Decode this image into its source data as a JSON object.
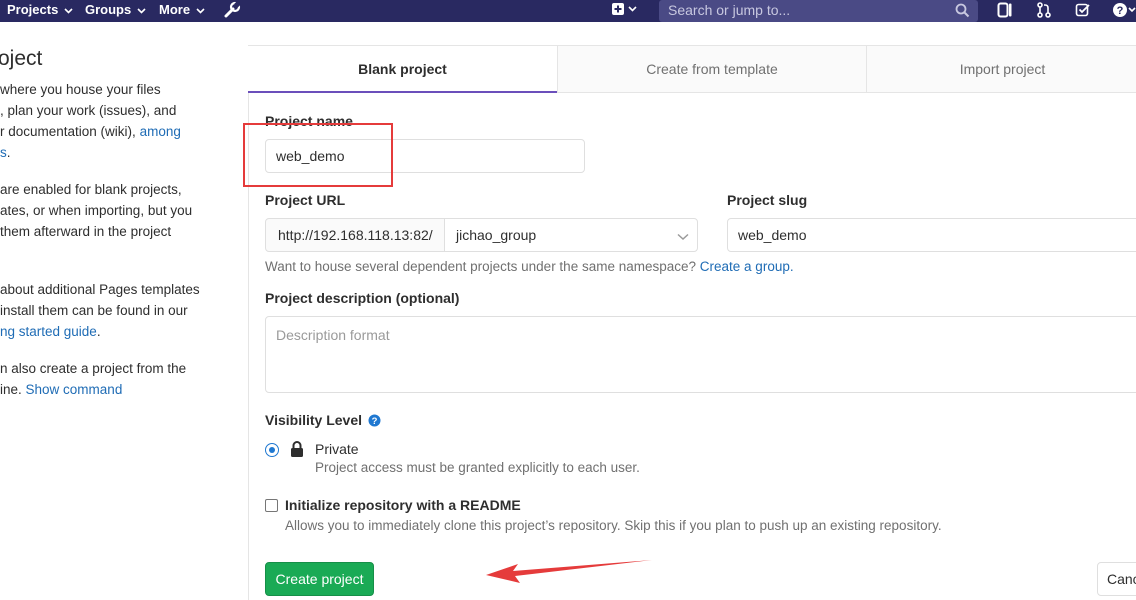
{
  "navbar": {
    "projects": "Projects",
    "groups": "Groups",
    "more": "More",
    "search_placeholder": "Search or jump to..."
  },
  "sidebar": {
    "title": "oject",
    "p1": {
      "l1": " where you house your files",
      "l2": ", plan your work (issues), and",
      "l3": "r documentation (wiki), ",
      "l3_link": "among",
      "l4_link": "s",
      "l4": "."
    },
    "p2": {
      "l1": "are enabled for blank projects,",
      "l2": "ates, or when importing, but you",
      "l3": " them afterward in the project"
    },
    "p3": {
      "l1": " about additional Pages templates",
      "l2": " install them can be found in our",
      "l3_link": "ng started guide",
      "l3": "."
    },
    "p4": {
      "l1": "n also create a project from the",
      "l2": "ine. ",
      "l2_link": "Show command"
    }
  },
  "tabs": {
    "blank": "Blank project",
    "template": "Create from template",
    "import": "Import project"
  },
  "form": {
    "name_label": "Project name",
    "name_value": "web_demo",
    "url_label": "Project URL",
    "url_prefix": "http://192.168.118.13:82/",
    "namespace": "jichao_group",
    "slug_label": "Project slug",
    "slug_value": "web_demo",
    "group_help": "Want to house several dependent projects under the same namespace? ",
    "group_help_link": "Create a group.",
    "desc_label": "Project description (optional)",
    "desc_placeholder": "Description format",
    "visibility_label": "Visibility Level",
    "private_label": "Private",
    "private_help": "Project access must be granted explicitly to each user.",
    "readme_label": "Initialize repository with a README",
    "readme_help": "Allows you to immediately clone this project’s repository. Skip this if you plan to push up an existing repository.",
    "create_button": "Create project",
    "cancel_button": "Cancel"
  },
  "colors": {
    "navbar": "#292961",
    "accent_tab": "#6b4fbb",
    "create_button": "#1aaa55",
    "link": "#1f6cb5",
    "annotation": "#e53b3b"
  },
  "icons": [
    "chevron-down-icon",
    "wrench-icon",
    "plus-square-icon",
    "search-icon",
    "sidebar-toggle-icon",
    "merge-request-icon",
    "todo-check-icon",
    "help-icon",
    "question-circle-icon",
    "lock-icon",
    "select-chevron-icon"
  ]
}
